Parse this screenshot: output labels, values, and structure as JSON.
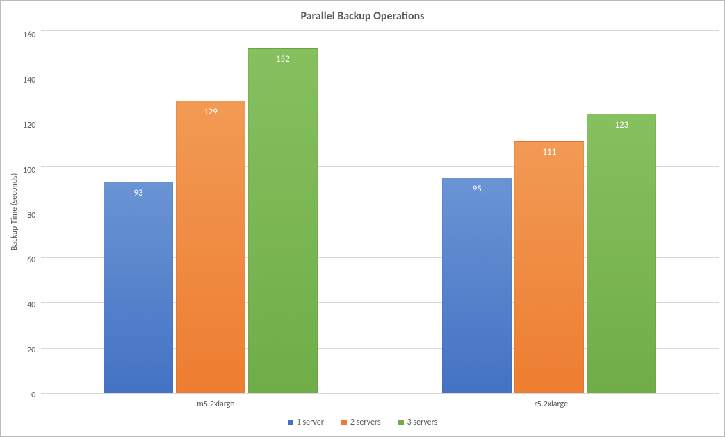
{
  "chart_data": {
    "type": "bar",
    "title": "Parallel Backup Operations",
    "ylabel": "Backup Time (seconds)",
    "xlabel": "",
    "ylim": [
      0,
      160
    ],
    "ystep": 20,
    "categories": [
      "m5.2xlarge",
      "r5.2xlarge"
    ],
    "series": [
      {
        "name": "1 server",
        "color": "#4472c4",
        "values": [
          93,
          95
        ]
      },
      {
        "name": "2 servers",
        "color": "#ed7d31",
        "values": [
          129,
          111
        ]
      },
      {
        "name": "3 servers",
        "color": "#70ad47",
        "values": [
          152,
          123
        ]
      }
    ],
    "yticks": [
      160,
      140,
      120,
      100,
      80,
      60,
      40,
      20,
      0
    ]
  }
}
